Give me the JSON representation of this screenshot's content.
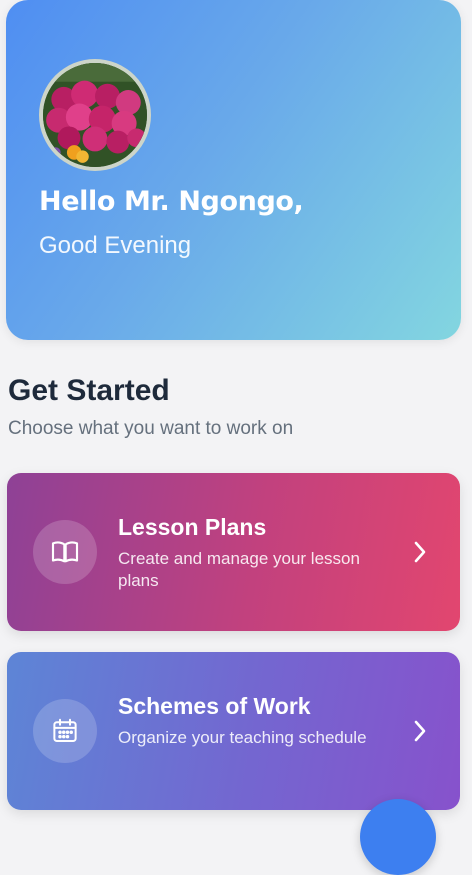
{
  "header": {
    "greeting_name": "Hello Mr. Ngongo,",
    "greeting_time": "Good Evening",
    "avatar_icon": "profile-photo-flowers"
  },
  "section": {
    "title": "Get Started",
    "subtitle": "Choose what you want to work on"
  },
  "cards": [
    {
      "title": "Lesson Plans",
      "description": "Create and manage your lesson plans",
      "icon": "book-icon",
      "chevron": "chevron-right-icon"
    },
    {
      "title": "Schemes of Work",
      "description": "Organize your teaching schedule",
      "icon": "calendar-icon",
      "chevron": "chevron-right-icon"
    }
  ],
  "colors": {
    "hero_start": "#4f8ef2",
    "hero_end": "#83d6e0",
    "lesson_start": "#8e4196",
    "lesson_end": "#e2466f",
    "schemes_start": "#5d85d6",
    "schemes_end": "#8752cc",
    "fab": "#3d7ff0"
  }
}
